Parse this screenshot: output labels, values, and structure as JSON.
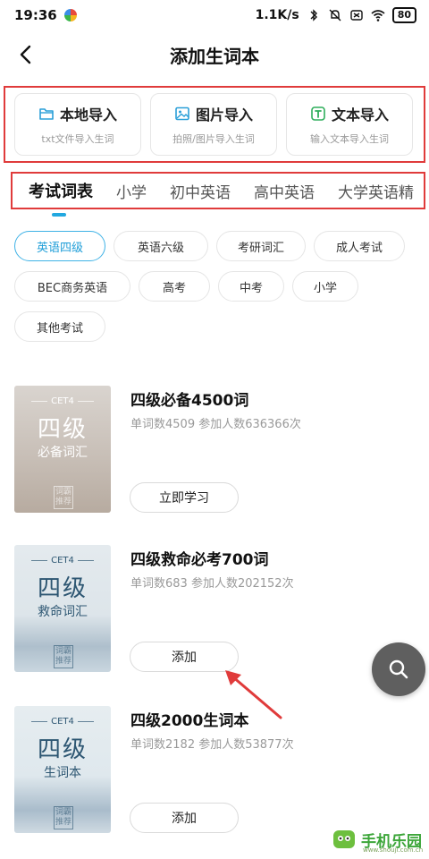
{
  "status_bar": {
    "time": "19:36",
    "speed": "1.1K/s",
    "battery": "80"
  },
  "header": {
    "title": "添加生词本"
  },
  "import_options": [
    {
      "label": "本地导入",
      "sub": "txt文件导入生词",
      "icon": "folder-icon"
    },
    {
      "label": "图片导入",
      "sub": "拍照/图片导入生词",
      "icon": "image-icon"
    },
    {
      "label": "文本导入",
      "sub": "输入文本导入生词",
      "icon": "text-icon"
    }
  ],
  "tabs": [
    {
      "label": "考试词表",
      "active": true
    },
    {
      "label": "小学",
      "active": false
    },
    {
      "label": "初中英语",
      "active": false
    },
    {
      "label": "高中英语",
      "active": false
    },
    {
      "label": "大学英语精",
      "active": false
    }
  ],
  "chips": [
    {
      "label": "英语四级",
      "active": true
    },
    {
      "label": "英语六级",
      "active": false
    },
    {
      "label": "考研词汇",
      "active": false
    },
    {
      "label": "成人考试",
      "active": false
    },
    {
      "label": "BEC商务英语",
      "active": false
    },
    {
      "label": "高考",
      "active": false
    },
    {
      "label": "中考",
      "active": false
    },
    {
      "label": "小学",
      "active": false
    },
    {
      "label": "其他考试",
      "active": false
    }
  ],
  "books": [
    {
      "name": "四级必备4500词",
      "meta": "单词数4509 参加人数636366次",
      "button": "立即学习",
      "cover": {
        "tag": "CET4",
        "big": "四级",
        "small": "必备词汇",
        "stamp": "词霸推荐"
      }
    },
    {
      "name": "四级救命必考700词",
      "meta": "单词数683 参加人数202152次",
      "button": "添加",
      "cover": {
        "tag": "CET4",
        "big": "四级",
        "small": "救命词汇",
        "stamp": "词霸推荐"
      }
    },
    {
      "name": "四级2000生词本",
      "meta": "单词数2182 参加人数53877次",
      "button": "添加",
      "cover": {
        "tag": "CET4",
        "big": "四级",
        "small": "生词本",
        "stamp": "词霸推荐"
      }
    }
  ],
  "fab": {
    "icon": "search-icon"
  },
  "watermark": {
    "text": "手机乐园",
    "url": "www.shouji.com.cn"
  },
  "colors": {
    "accent": "#22a8e0",
    "annotation": "#e03b3b",
    "fab": "#5f5f5f"
  }
}
